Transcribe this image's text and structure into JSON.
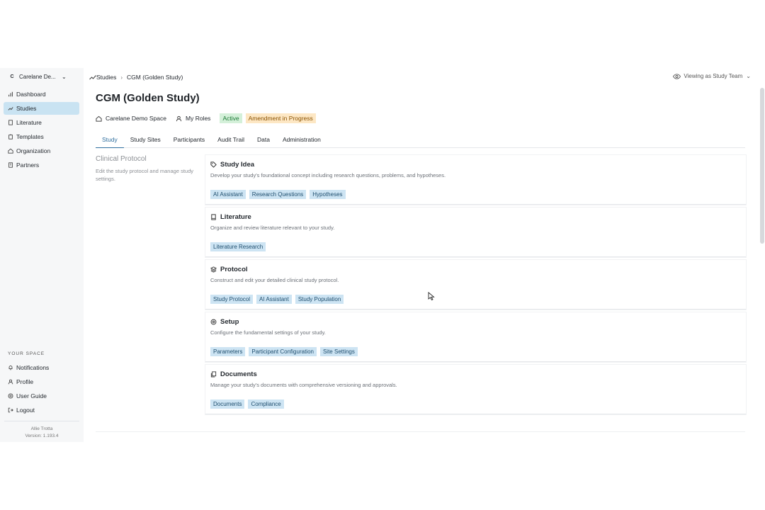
{
  "sidebar": {
    "workspace": {
      "initial": "C",
      "name": "Carelane De..."
    },
    "items": [
      {
        "label": "Dashboard",
        "icon": "bar-chart-icon"
      },
      {
        "label": "Studies",
        "icon": "trend-icon",
        "active": true
      },
      {
        "label": "Literature",
        "icon": "book-icon"
      },
      {
        "label": "Templates",
        "icon": "clipboard-icon"
      },
      {
        "label": "Organization",
        "icon": "home-icon"
      },
      {
        "label": "Partners",
        "icon": "building-icon"
      }
    ],
    "section_label": "YOUR SPACE",
    "bottom_items": [
      {
        "label": "Notifications",
        "icon": "bell-icon"
      },
      {
        "label": "Profile",
        "icon": "user-icon"
      },
      {
        "label": "User Guide",
        "icon": "help-icon"
      },
      {
        "label": "Logout",
        "icon": "logout-icon"
      }
    ],
    "footer": {
      "user": "Allie Trotta",
      "version": "Version: 1.193.4"
    }
  },
  "topbar": {
    "breadcrumb": [
      "Studies",
      "CGM (Golden Study)"
    ],
    "viewing": "Viewing as Study Team"
  },
  "page": {
    "title": "CGM (Golden Study)",
    "space": "Carelane Demo Space",
    "roles": "My Roles",
    "status": "Active",
    "amendment": "Amendment in Progress"
  },
  "tabs": [
    "Study",
    "Study Sites",
    "Participants",
    "Audit Trail",
    "Data",
    "Administration"
  ],
  "left_panel": {
    "title": "Clinical Protocol",
    "description": "Edit the study protocol and manage study settings."
  },
  "cards": [
    {
      "title": "Study Idea",
      "icon": "tag-icon",
      "description": "Develop your study's foundational concept including research questions, problems, and hypotheses.",
      "chips": [
        "AI Assistant",
        "Research Questions",
        "Hypotheses"
      ]
    },
    {
      "title": "Literature",
      "icon": "book-icon",
      "description": "Organize and review literature relevant to your study.",
      "chips": [
        "Literature Research"
      ]
    },
    {
      "title": "Protocol",
      "icon": "layers-icon",
      "description": "Construct and edit your detailed clinical study protocol.",
      "chips": [
        "Study Protocol",
        "AI Assistant",
        "Study Population"
      ]
    },
    {
      "title": "Setup",
      "icon": "gear-icon",
      "description": "Configure the fundamental settings of your study.",
      "chips": [
        "Parameters",
        "Participant Configuration",
        "Site Settings"
      ]
    },
    {
      "title": "Documents",
      "icon": "documents-icon",
      "description": "Manage your study's documents with comprehensive versioning and approvals.",
      "chips": [
        "Documents",
        "Compliance"
      ]
    }
  ],
  "colors": {
    "active_nav": "#c9e3f2",
    "chip": "#cde4f3",
    "active_badge": "#d4f0d9",
    "amend_badge": "#fde7c4",
    "tab_accent": "#2f6e9e"
  }
}
